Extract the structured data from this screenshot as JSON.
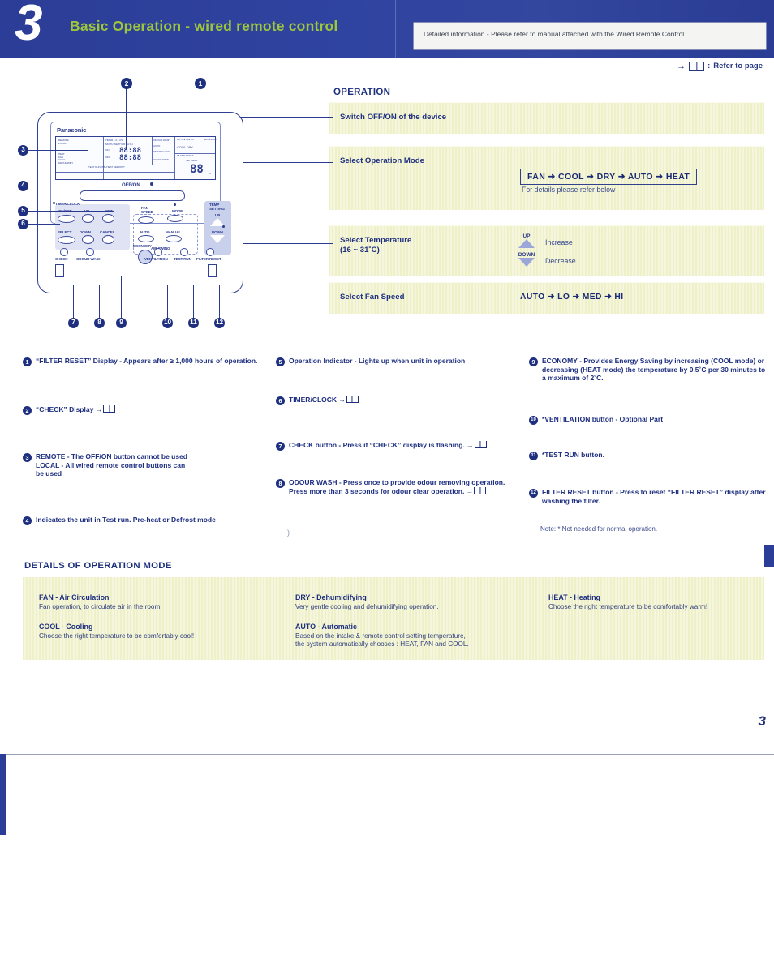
{
  "header": {
    "chapter_number": "3",
    "title": "Basic Operation - wired remote control",
    "info_box": "Detailed information - Please refer to manual attached with the Wired Remote Control",
    "refer_legend": "Refer to page",
    "refer_icon": "book-icon"
  },
  "operation": {
    "section_title": "OPERATION",
    "rows": [
      {
        "label": "Switch OFF/ON of the device"
      },
      {
        "label": "Select Operation Mode",
        "mode_sequence": "FAN ➜ COOL ➜ DRY ➜ AUTO ➜ HEAT",
        "note": "For details please refer below"
      },
      {
        "label": "Select Temperature\n(16 ~ 31˚C)",
        "up_label": "UP",
        "up_text": "Increase",
        "down_label": "DOWN",
        "down_text": "Decrease"
      },
      {
        "label": "Select Fan Speed",
        "fan_sequence": "AUTO ➜ LO ➜ MED ➜ HI"
      }
    ]
  },
  "remote": {
    "brand": "Panasonic",
    "onoff_label": "OFF/ON",
    "lcd": {
      "remote_local": "REMOTE\nLOCAL",
      "timer_row": "TIMER   1  2  3  4  5",
      "days": "MO TU WE TH FR SA SU",
      "on_label": "ON",
      "off_label": "OFF",
      "on_time": "88:88",
      "off_time": "88:88",
      "left_modes": "HEAT\nFAN\nCOOL\nDEHUMIDIFY",
      "status_line": "TEST RUN  PRE-HEAT  DEFROST",
      "mid_top": "ODOUR WASH",
      "mid_auto": "AUTO",
      "mid_time": "TIMER CLOCK",
      "mid_vent": "VENTILATION",
      "mode_seq": "AUTO ▸ HI ▸ LO",
      "mode_seq2": "COOL  DRY",
      "economy": "ECONOMY",
      "filter_reset": "FILTER RESET",
      "set_temp": "SET TEMP",
      "temp_value": "88",
      "temp_unit": "˚C"
    },
    "buttons": [
      {
        "name": "on-off-mode-button",
        "label": "ON/OFF"
      },
      {
        "name": "up-button",
        "label": "UP"
      },
      {
        "name": "set-button",
        "label": "SET"
      },
      {
        "name": "select-button",
        "label": "SELECT"
      },
      {
        "name": "down-button",
        "label": "DOWN"
      },
      {
        "name": "cancel-button",
        "label": "CANCEL"
      },
      {
        "name": "fan-speed-button",
        "label": "FAN\nSPEED"
      },
      {
        "name": "mode-button",
        "label": "MODE"
      },
      {
        "name": "auto-button",
        "label": "AUTO"
      },
      {
        "name": "manual-button",
        "label": "MANUAL"
      },
      {
        "name": "air-swing-label",
        "label": "AIR SWING"
      },
      {
        "name": "temp-setting-label",
        "label": "TEMP\nSETTING"
      },
      {
        "name": "temp-up-button",
        "label": "UP"
      },
      {
        "name": "temp-down-button",
        "label": "DOWN"
      },
      {
        "name": "check-button",
        "label": "CHECK"
      },
      {
        "name": "odour-wash-button",
        "label": "ODOUR WASH"
      },
      {
        "name": "economy-button",
        "label": "ECONOMY"
      },
      {
        "name": "ventilation-button",
        "label": "VENTILATION"
      },
      {
        "name": "test-run-button",
        "label": "TEST RUN"
      },
      {
        "name": "filter-reset-button",
        "label": "FILTER RESET"
      }
    ],
    "timer_clock_label": "TIMER/CLOCK",
    "callouts": [
      "1",
      "2",
      "3",
      "4",
      "5",
      "6",
      "7",
      "8",
      "9",
      "10",
      "11",
      "12"
    ]
  },
  "footnotes": {
    "col1": [
      {
        "num": "1",
        "text": "“FILTER RESET” Display - Appears after ≥ 1,000 hours of operation."
      },
      {
        "num": "2",
        "text": "“CHECK” Display →",
        "book": true
      },
      {
        "num": "3",
        "text": "REMOTE - The OFF/ON button cannot be used\nLOCAL - All wired remote control buttons can\n              be used"
      },
      {
        "num": "4",
        "text": "Indicates the unit in Test run. Pre-heat or Defrost mode"
      }
    ],
    "col2": [
      {
        "num": "5",
        "text": "Operation Indicator - Lights up when unit in operation"
      },
      {
        "num": "6",
        "text": "TIMER/CLOCK →",
        "book": true
      },
      {
        "num": "7",
        "text": "CHECK button - Press if “CHECK” display is flashing. →",
        "book": true
      },
      {
        "num": "8",
        "text": "ODOUR WASH - Press once to provide odour removing operation. Press more than 3 seconds for odour clear operation. →",
        "book": true
      }
    ],
    "col3": [
      {
        "num": "9",
        "text": "ECONOMY - Provides Energy Saving by increasing (COOL mode) or decreasing (HEAT mode) the temperature by 0.5˚C per 30 minutes to a maximum of 2˚C."
      },
      {
        "num": "10",
        "text": "*VENTILATION button - Optional Part"
      },
      {
        "num": "11",
        "text": "*TEST RUN button."
      },
      {
        "num": "12",
        "text": "FILTER RESET button - Press to reset “FILTER RESET” display after washing the filter."
      }
    ],
    "note": "Note: * Not needed for normal operation."
  },
  "details": {
    "title": "DETAILS OF OPERATION MODE",
    "items": [
      {
        "heading": "FAN - Air Circulation",
        "body": "Fan operation, to circulate air in the room."
      },
      {
        "heading": "COOL - Cooling",
        "body": "Choose the right temperature to be comfortably cool!"
      },
      {
        "heading": "DRY - Dehumidifying",
        "body": "Very gentle cooling and dehumidifying operation."
      },
      {
        "heading": "AUTO - Automatic",
        "body": "Based on the intake & remote control setting temperature,\nthe system automatically chooses : HEAT, FAN and COOL."
      },
      {
        "heading": "HEAT - Heating",
        "body": "Choose the right temperature to be comfortably warm!"
      }
    ]
  },
  "page_number": "3",
  "colors": {
    "header_blue": "#2b3d96",
    "title_green": "#9ec63b",
    "text_blue": "#1e2f80",
    "band_yellow": "#eef0c8"
  }
}
